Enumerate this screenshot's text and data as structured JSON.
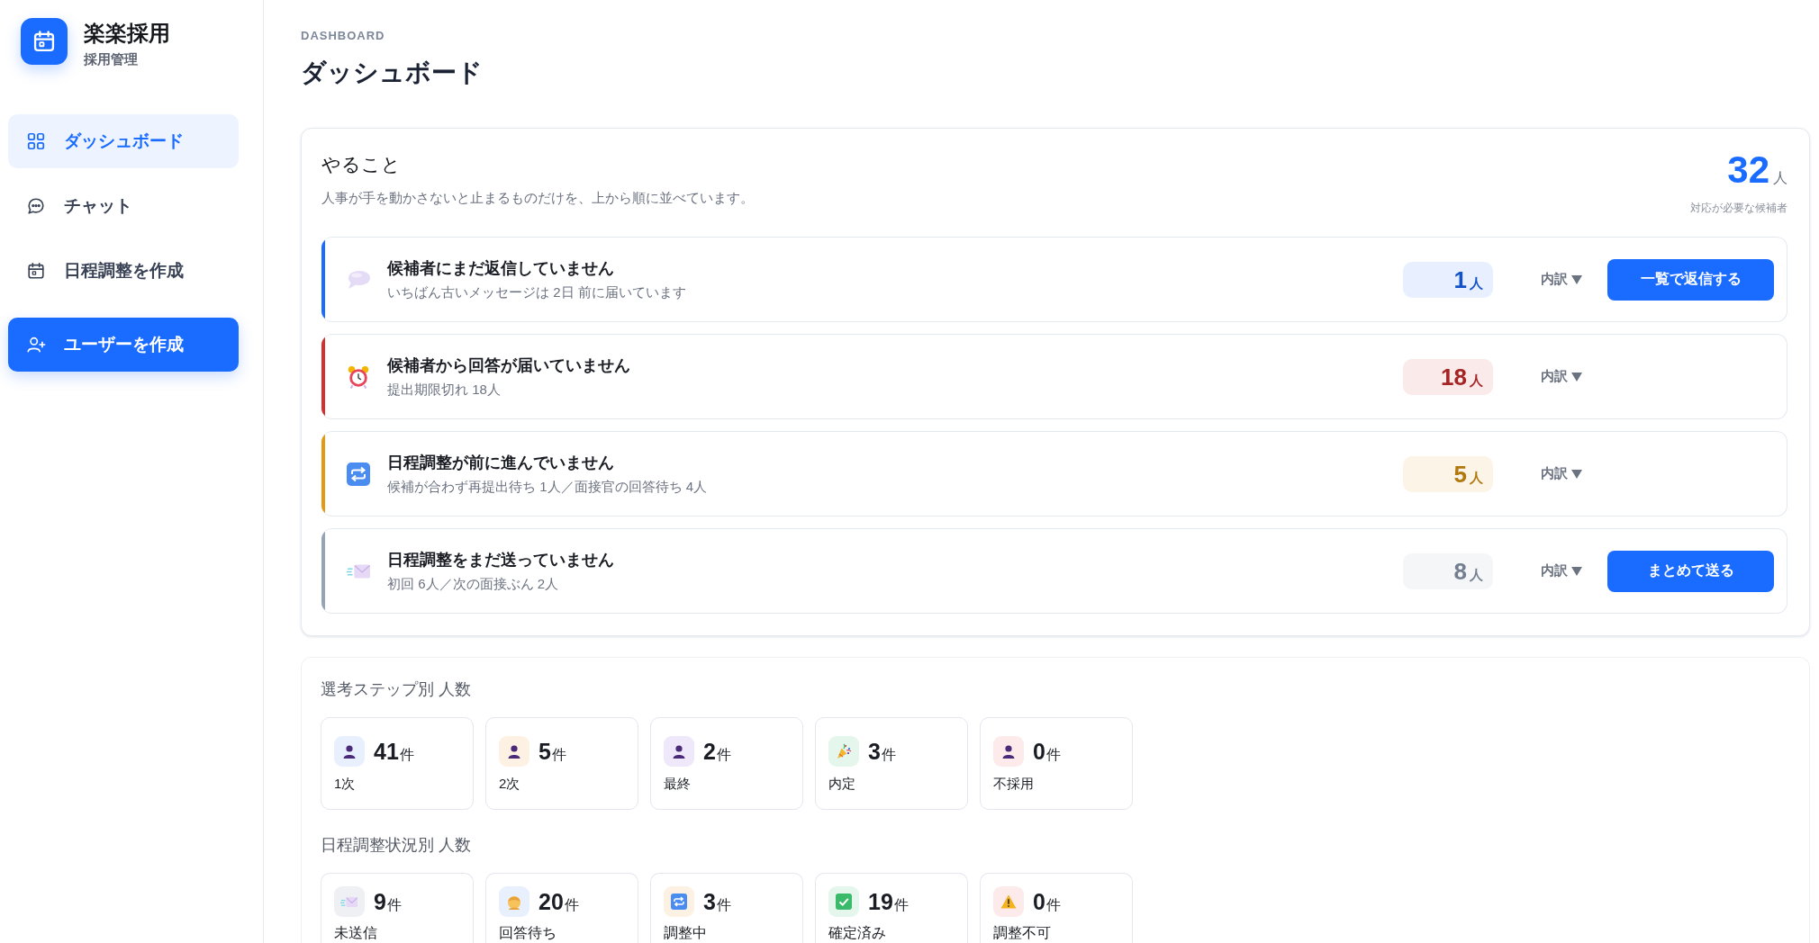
{
  "sidebar": {
    "app_name": "楽楽採用",
    "app_subtitle": "採用管理",
    "items": [
      {
        "label": "ダッシュボード",
        "selected": true
      },
      {
        "label": "チャット",
        "selected": false
      },
      {
        "label": "日程調整を作成",
        "selected": false
      }
    ],
    "create_button": "ユーザーを作成"
  },
  "header": {
    "eyebrow": "DASHBOARD",
    "title": "ダッシュボード"
  },
  "todo": {
    "title": "やること",
    "description": "人事が手を動かさないと止まるものだけを、上から順に並べています。",
    "total": {
      "value": "32",
      "unit": "人",
      "caption": "対応が必要な候補者"
    },
    "items": [
      {
        "title": "候補者にまだ返信していません",
        "detail": "いちばん古いメッセージは 2日 前に届いています",
        "count": "1",
        "unit": "人",
        "color": "#1a6bff",
        "breakdown": "内訳",
        "action": "一覧で返信する"
      },
      {
        "title": "候補者から回答が届いていません",
        "detail": "提出期限切れ 18人",
        "count": "18",
        "unit": "人",
        "color": "#d32f2f",
        "breakdown": "内訳"
      },
      {
        "title": "日程調整が前に進んでいません",
        "detail": "候補が合わず再提出待ち 1人／面接官の回答待ち 4人",
        "count": "5",
        "unit": "人",
        "color": "#e39a12",
        "breakdown": "内訳"
      },
      {
        "title": "日程調整をまだ送っていません",
        "detail": "初回 6人／次の面接ぶん 2人",
        "count": "8",
        "unit": "人",
        "color": "#94a3b8",
        "breakdown": "内訳",
        "action": "まとめて送る"
      }
    ]
  },
  "step_counts": {
    "title": "選考ステップ別 人数",
    "items": [
      {
        "count": "41",
        "unit": "件",
        "label": "1次",
        "color": "#e8f0fe"
      },
      {
        "count": "5",
        "unit": "件",
        "label": "2次",
        "color": "#fdf1e3"
      },
      {
        "count": "2",
        "unit": "件",
        "label": "最終",
        "color": "#efe8fb"
      },
      {
        "count": "3",
        "unit": "件",
        "label": "内定",
        "color": "#e5f6ec"
      },
      {
        "count": "0",
        "unit": "件",
        "label": "不採用",
        "color": "#fdeaea"
      }
    ]
  },
  "schedule_counts": {
    "title": "日程調整状況別 人数",
    "items": [
      {
        "count": "9",
        "unit": "件",
        "label": "未送信",
        "color": "#eef0f4"
      },
      {
        "count": "20",
        "unit": "件",
        "label": "回答待ち",
        "color": "#e8f0fe"
      },
      {
        "count": "3",
        "unit": "件",
        "label": "調整中",
        "color": "#fdf1e3"
      },
      {
        "count": "19",
        "unit": "件",
        "label": "確定済み",
        "color": "#e5f6ec"
      },
      {
        "count": "0",
        "unit": "件",
        "label": "調整不可",
        "color": "#fdeaea"
      }
    ]
  }
}
